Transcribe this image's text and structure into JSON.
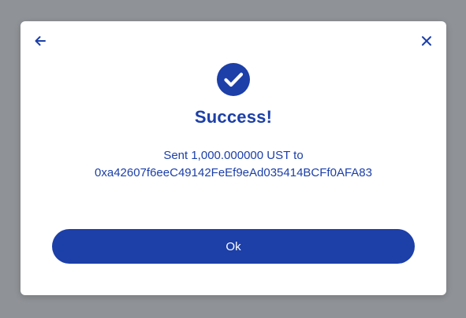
{
  "dialog": {
    "title": "Success!",
    "message": {
      "line1": "Sent 1,000.000000 UST to",
      "line2": "0xa42607f6eeC49142FeEf9eAd035414BCFf0AFA83"
    },
    "ok_label": "Ok",
    "icons": {
      "back": "arrow-left-icon",
      "close": "close-icon",
      "status": "check-circle-icon"
    }
  },
  "colors": {
    "accent": "#1c3fa8",
    "backdrop": "#8f9296",
    "surface": "#ffffff"
  }
}
